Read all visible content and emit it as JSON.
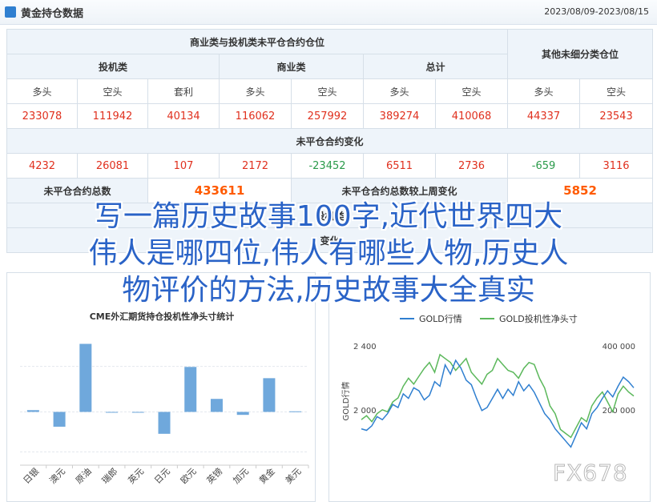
{
  "header": {
    "title": "黄金持仓数据",
    "daterange": "2023/08/09-2023/08/15"
  },
  "table": {
    "group_commercial": "商业类与投机类未平仓合约仓位",
    "group_other": "其他未细分类仓位",
    "spec": "投机类",
    "commercial": "商业类",
    "total": "总计",
    "col_long": "多头",
    "col_short": "空头",
    "col_arb": "套利",
    "values": [
      "233078",
      "111942",
      "40134",
      "116062",
      "257992",
      "389274",
      "410068",
      "44337",
      "23543"
    ],
    "change_title": "未平仓合约变化",
    "changes": [
      "4232",
      "26081",
      "107",
      "2172",
      "-23452",
      "6511",
      "2736",
      "-659",
      "3116"
    ],
    "oi_total_label": "未平仓合约总数",
    "oi_total": "433611",
    "oi_change_label": "未平仓合约总数较上周变化",
    "oi_change": "5852",
    "hidden_row_a": "投机类",
    "hidden_row_b": "变化"
  },
  "overlay": {
    "line1": "写一篇历史故事100字,近代世界四大",
    "line2": "伟人是哪四位,伟人有哪些人物,历史人",
    "line3": "物评价的方法,历史故事大全真实"
  },
  "chart_data": [
    {
      "type": "bar",
      "title": "CME外汇期货持仓投机性净头寸统计",
      "categories": [
        "日银",
        "澳元",
        "原油",
        "瑞郎",
        "英元",
        "日元",
        "欧元",
        "英镑",
        "加元",
        "黄金",
        "美元"
      ],
      "values": [
        0.3,
        -2.5,
        11.5,
        -0.1,
        -0.1,
        -3.7,
        7.6,
        2.2,
        -0.5,
        5.7,
        0.1
      ],
      "ylim": [
        -9,
        14
      ],
      "gridlines": 2
    },
    {
      "type": "line",
      "legend": [
        "GOLD行情",
        "GOLD投机性净头寸"
      ],
      "colors": [
        "#2f7fd0",
        "#5cb85c"
      ],
      "ylabel": "GOLD行情",
      "left_ticks": [
        "2 400",
        "2 000"
      ],
      "right_ticks": [
        "400 000",
        "200 000"
      ],
      "series": [
        {
          "name": "GOLD行情",
          "values": [
            1830,
            1825,
            1840,
            1870,
            1860,
            1880,
            1910,
            1900,
            1945,
            1930,
            1965,
            1955,
            1925,
            1940,
            1985,
            1970,
            2040,
            2010,
            2055,
            2030,
            1990,
            1975,
            1930,
            1890,
            1900,
            1930,
            1960,
            1930,
            1960,
            1940,
            1985,
            1955,
            1975,
            1950,
            1915,
            1880,
            1860,
            1830,
            1810,
            1790,
            1770,
            1810,
            1850,
            1830,
            1880,
            1900,
            1930,
            1955,
            1935,
            1970,
            2000,
            1985,
            1965
          ]
        },
        {
          "name": "GOLD投机性净头寸",
          "values": [
            145000,
            155000,
            140000,
            160000,
            170000,
            165000,
            190000,
            200000,
            230000,
            250000,
            235000,
            255000,
            275000,
            290000,
            265000,
            310000,
            300000,
            290000,
            270000,
            285000,
            300000,
            265000,
            250000,
            235000,
            260000,
            270000,
            300000,
            285000,
            270000,
            265000,
            250000,
            275000,
            290000,
            285000,
            250000,
            225000,
            180000,
            160000,
            120000,
            110000,
            100000,
            125000,
            150000,
            140000,
            180000,
            200000,
            215000,
            190000,
            165000,
            210000,
            230000,
            215000,
            205000
          ]
        }
      ]
    }
  ],
  "watermark": "FX678"
}
